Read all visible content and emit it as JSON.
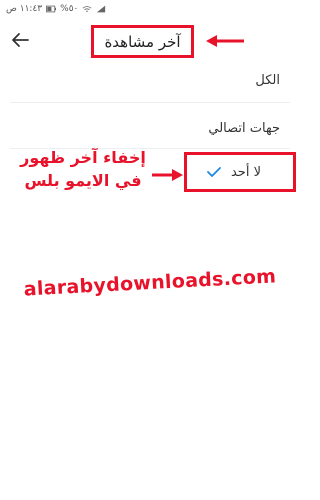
{
  "status_bar": {
    "time": "١١:٤٣ ص",
    "battery": "%٥٠"
  },
  "app_bar": {
    "title": "آخر مشاهدة"
  },
  "options": [
    {
      "label": "الكل"
    },
    {
      "label": "جهات اتصالي"
    },
    {
      "label": "لا أحد",
      "selected": true
    }
  ],
  "annotation": {
    "line1": "إخفاء آخر ظهور",
    "line2": "في الايمو بلس"
  },
  "watermark": "alarabydownloads.com",
  "colors": {
    "highlight": "#e8132b",
    "check": "#1e88e5"
  }
}
